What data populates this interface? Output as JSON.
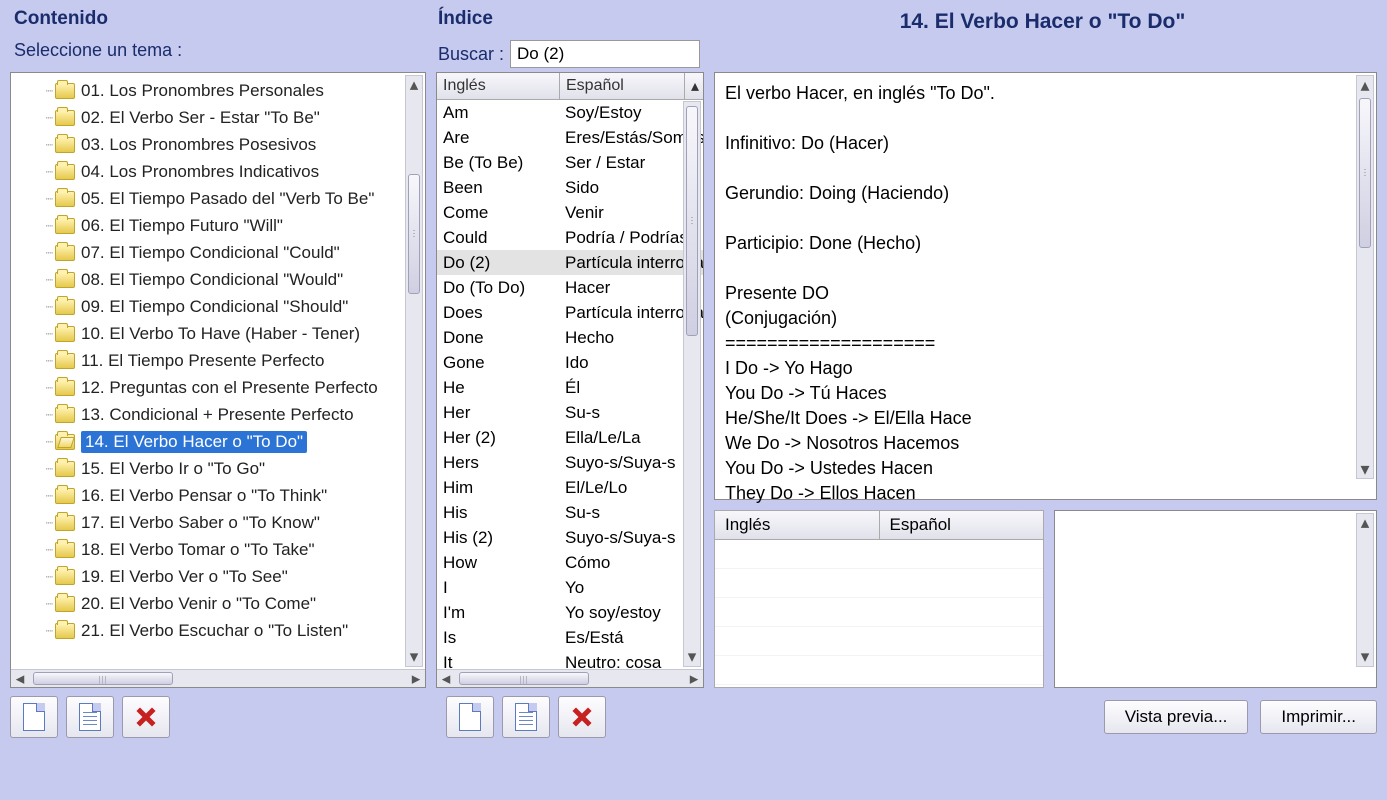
{
  "contents": {
    "title": "Contenido",
    "prompt": "Seleccione un tema :",
    "items": [
      "01. Los Pronombres Personales",
      "02. El Verbo Ser - Estar \"To Be\"",
      "03. Los Pronombres Posesivos",
      "04. Los Pronombres Indicativos",
      "05. El Tiempo Pasado del \"Verb To Be\"",
      "06. El Tiempo Futuro \"Will\"",
      "07. El Tiempo Condicional \"Could\"",
      "08. El Tiempo Condicional \"Would\"",
      "09. El Tiempo Condicional \"Should\"",
      "10. El Verbo To Have (Haber - Tener)",
      "11. El Tiempo Presente Perfecto",
      "12. Preguntas con el Presente Perfecto",
      "13. Condicional + Presente Perfecto",
      "14. El Verbo Hacer o \"To Do\"",
      "15. El Verbo Ir o \"To Go\"",
      "16. El Verbo Pensar o \"To Think\"",
      "17. El Verbo Saber o \"To Know\"",
      "18. El Verbo Tomar o \"To Take\"",
      "19. El Verbo Ver o \"To See\"",
      "20. El Verbo Venir o \"To Come\"",
      "21. El Verbo Escuchar o \"To Listen\""
    ],
    "selected_index": 13
  },
  "index": {
    "title": "Índice",
    "search_label": "Buscar :",
    "search_value": "Do (2)",
    "col_en": "Inglés",
    "col_es": "Español",
    "rows": [
      {
        "en": "Am",
        "es": "Soy/Estoy"
      },
      {
        "en": "Are",
        "es": "Eres/Estás/Somos"
      },
      {
        "en": "Be (To Be)",
        "es": "Ser / Estar"
      },
      {
        "en": "Been",
        "es": "Sido"
      },
      {
        "en": "Come",
        "es": "Venir"
      },
      {
        "en": "Could",
        "es": "Podría / Podrías"
      },
      {
        "en": "Do (2)",
        "es": "Partícula interrogativa"
      },
      {
        "en": "Do (To Do)",
        "es": "Hacer"
      },
      {
        "en": "Does",
        "es": "Partícula interrogativa"
      },
      {
        "en": "Done",
        "es": "Hecho"
      },
      {
        "en": "Gone",
        "es": "Ido"
      },
      {
        "en": "He",
        "es": "Él"
      },
      {
        "en": "Her",
        "es": "Su-s"
      },
      {
        "en": "Her (2)",
        "es": "Ella/Le/La"
      },
      {
        "en": "Hers",
        "es": "Suyo-s/Suya-s"
      },
      {
        "en": "Him",
        "es": "El/Le/Lo"
      },
      {
        "en": "His",
        "es": "Su-s"
      },
      {
        "en": "His (2)",
        "es": "Suyo-s/Suya-s"
      },
      {
        "en": "How",
        "es": "Cómo"
      },
      {
        "en": "I",
        "es": "Yo"
      },
      {
        "en": "I'm",
        "es": "Yo soy/estoy"
      },
      {
        "en": "Is",
        "es": "Es/Está"
      },
      {
        "en": "It",
        "es": "Neutro: cosa"
      }
    ],
    "selected_index": 6
  },
  "article": {
    "title": "14. El Verbo Hacer o \"To Do\"",
    "body": "El verbo Hacer, en inglés \"To Do\".\n\nInfinitivo: Do (Hacer)\n\nGerundio: Doing (Haciendo)\n\nParticipio: Done (Hecho)\n\nPresente DO\n(Conjugación)\n====================\nI Do -> Yo Hago\nYou Do -> Tú Haces\nHe/She/It Does -> El/Ella Hace\nWe Do -> Nosotros Hacemos\nYou Do -> Ustedes Hacen\nThey Do -> Ellos Hacen"
  },
  "mini_table": {
    "col_en": "Inglés",
    "col_es": "Español"
  },
  "buttons": {
    "preview": "Vista previa...",
    "print": "Imprimir..."
  }
}
